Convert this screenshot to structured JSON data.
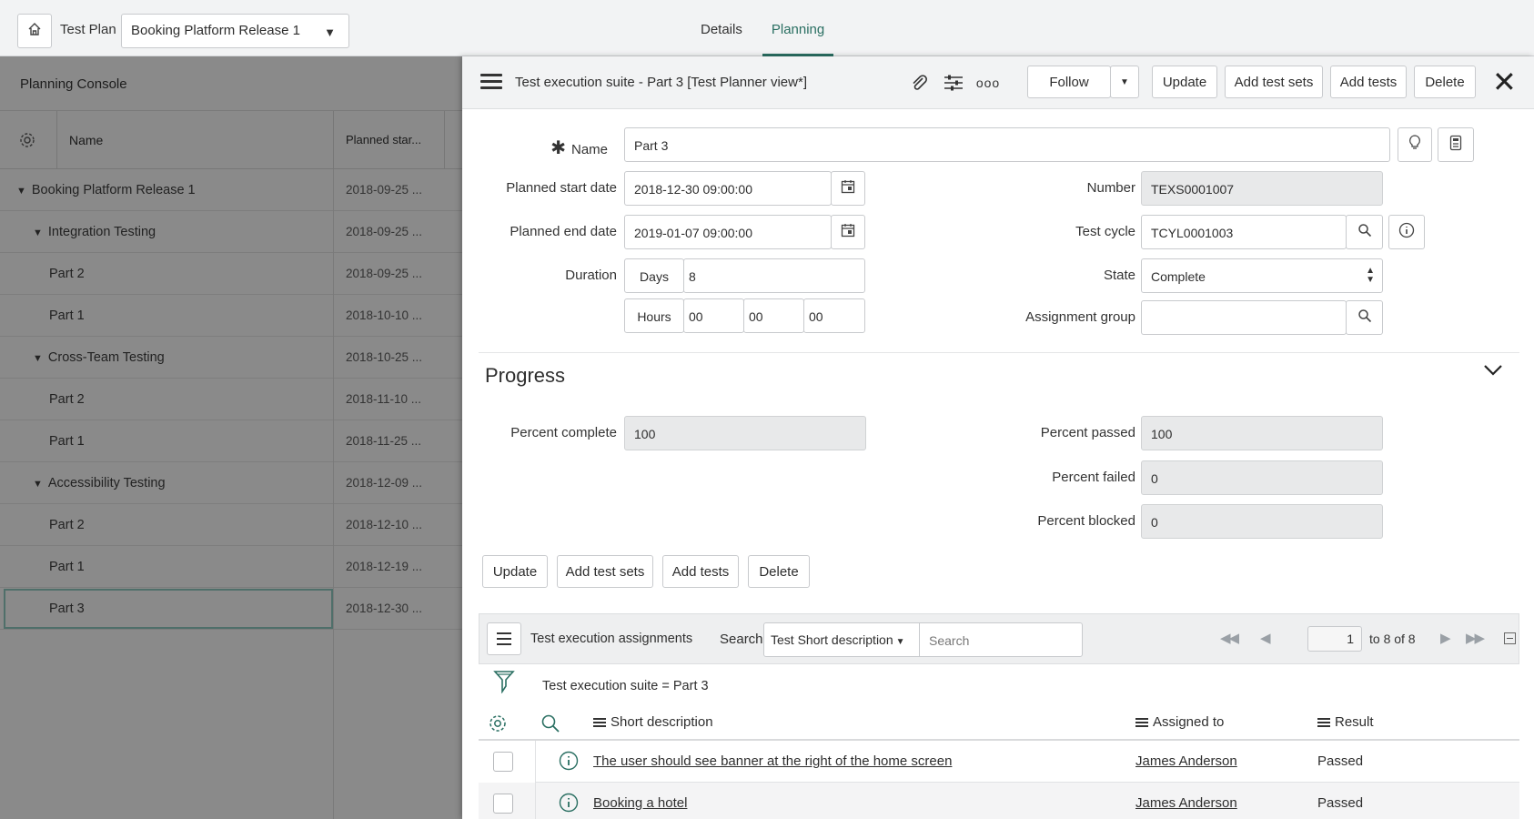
{
  "topbar": {
    "test_plan_label": "Test Plan",
    "test_plan_value": "Booking Platform Release 1",
    "tabs": [
      {
        "label": "Details",
        "active": false
      },
      {
        "label": "Planning",
        "active": true
      }
    ]
  },
  "planning_console": {
    "title": "Planning Console",
    "columns": {
      "name": "Name",
      "planned_start": "Planned star..."
    },
    "rows": [
      {
        "name": "Booking Platform Release 1",
        "start": "2018-09-25 ...",
        "level": 0,
        "expanded": true
      },
      {
        "name": "Integration Testing",
        "start": "2018-09-25 ...",
        "level": 1,
        "expanded": true
      },
      {
        "name": "Part 2",
        "start": "2018-09-25 ...",
        "level": 2
      },
      {
        "name": "Part 1",
        "start": "2018-10-10 ...",
        "level": 2
      },
      {
        "name": "Cross-Team Testing",
        "start": "2018-10-25 ...",
        "level": 1,
        "expanded": true
      },
      {
        "name": "Part 2",
        "start": "2018-11-10 ...",
        "level": 2
      },
      {
        "name": "Part 1",
        "start": "2018-11-25 ...",
        "level": 2
      },
      {
        "name": "Accessibility Testing",
        "start": "2018-12-09 ...",
        "level": 1,
        "expanded": true
      },
      {
        "name": "Part 2",
        "start": "2018-12-10 ...",
        "level": 2
      },
      {
        "name": "Part 1",
        "start": "2018-12-19 ...",
        "level": 2
      },
      {
        "name": "Part 3",
        "start": "2018-12-30 ...",
        "level": 2,
        "selected": true
      }
    ]
  },
  "panel": {
    "title": "Test execution suite - Part 3 [Test Planner view*]",
    "buttons": {
      "follow": "Follow",
      "update": "Update",
      "add_test_sets": "Add test sets",
      "add_tests": "Add tests",
      "delete": "Delete"
    }
  },
  "form": {
    "name_label": "Name",
    "name_value": "Part 3",
    "planned_start_label": "Planned start date",
    "planned_start_value": "2018-12-30 09:00:00",
    "planned_end_label": "Planned end date",
    "planned_end_value": "2019-01-07 09:00:00",
    "duration_label": "Duration",
    "days_label": "Days",
    "days_value": "8",
    "hours_label": "Hours",
    "hours_value": "00",
    "minutes_value": "00",
    "seconds_value": "00",
    "number_label": "Number",
    "number_value": "TEXS0001007",
    "test_cycle_label": "Test cycle",
    "test_cycle_value": "TCYL0001003",
    "state_label": "State",
    "state_value": "Complete",
    "assignment_group_label": "Assignment group",
    "assignment_group_value": ""
  },
  "progress": {
    "title": "Progress",
    "percent_complete_label": "Percent complete",
    "percent_complete_value": "100",
    "percent_passed_label": "Percent passed",
    "percent_passed_value": "100",
    "percent_failed_label": "Percent failed",
    "percent_failed_value": "0",
    "percent_blocked_label": "Percent blocked",
    "percent_blocked_value": "0"
  },
  "bottom_buttons": {
    "update": "Update",
    "add_test_sets": "Add test sets",
    "add_tests": "Add tests",
    "delete": "Delete"
  },
  "related_list": {
    "title": "Test execution assignments",
    "search_label": "Search",
    "search_field": "Test Short description",
    "search_placeholder": "Search",
    "page_value": "1",
    "page_range": "to 8 of 8",
    "filter_text": "Test execution suite = Part 3",
    "columns": {
      "short_description": "Short description",
      "assigned_to": "Assigned to",
      "result": "Result"
    },
    "rows": [
      {
        "short_description": "The user should see banner at the right of the home screen",
        "assigned_to": "James Anderson",
        "result": "Passed"
      },
      {
        "short_description": "Booking a hotel",
        "assigned_to": "James Anderson",
        "result": "Passed"
      }
    ]
  },
  "colors": {
    "accent": "#2a6f62",
    "dim_overlay": "#8a8a8a",
    "readonly_bg": "#e8e9ea"
  }
}
